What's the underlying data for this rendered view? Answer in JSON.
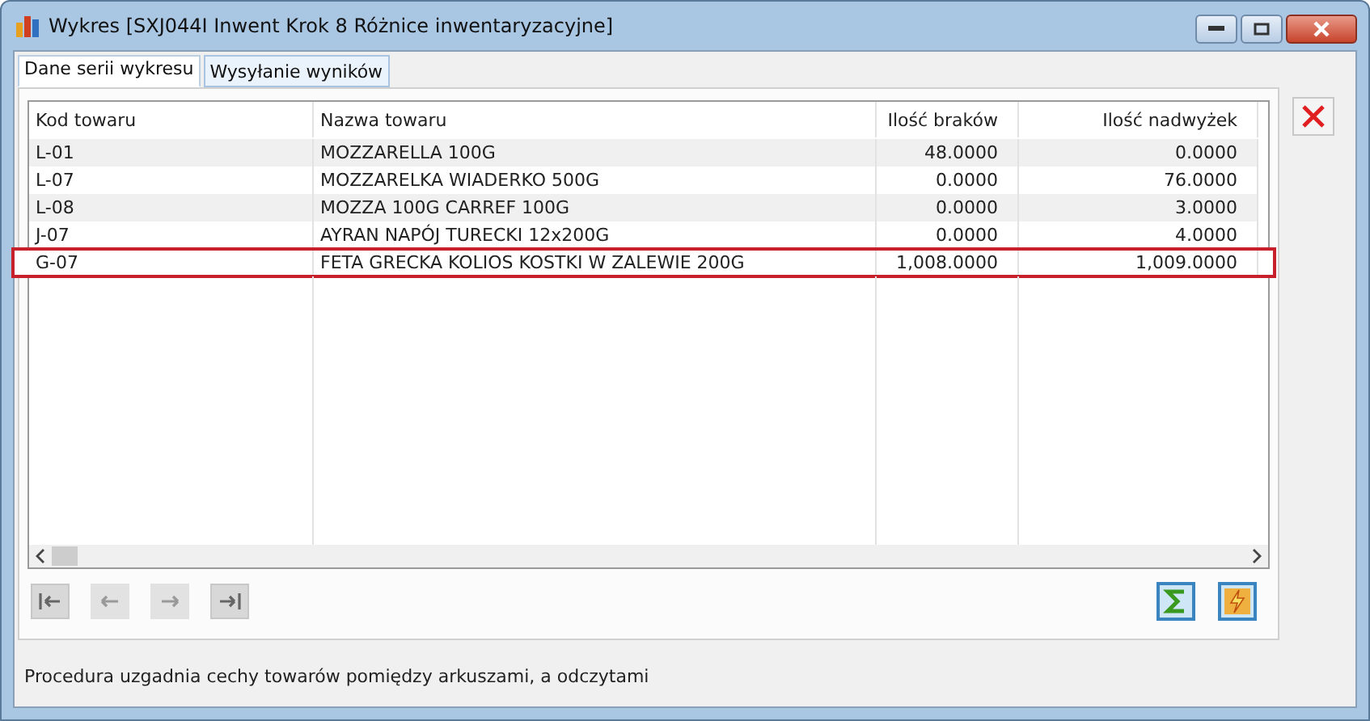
{
  "window": {
    "title": "Wykres [SXJ044I  Inwent Krok 8 Różnice inwentaryzacyjne]"
  },
  "tabs": [
    {
      "label": "Dane serii wykresu",
      "selected": true
    },
    {
      "label": "Wysyłanie wyników",
      "selected": false
    }
  ],
  "table": {
    "columns": [
      "Kod towaru",
      "Nazwa towaru",
      "Ilość braków",
      "Ilość nadwyżek"
    ],
    "rows": [
      {
        "cells": [
          "L-01",
          "MOZZARELLA 100G",
          "48.0000",
          "0.0000"
        ],
        "selected": false
      },
      {
        "cells": [
          "L-07",
          "MOZZARELKA WIADERKO 500G",
          "0.0000",
          "76.0000"
        ],
        "selected": false
      },
      {
        "cells": [
          "L-08",
          "MOZZA 100G CARREF 100G",
          "0.0000",
          "3.0000"
        ],
        "selected": false
      },
      {
        "cells": [
          "J-07",
          "AYRAN NAPÓJ TURECKI 12x200G",
          "0.0000",
          "4.0000"
        ],
        "selected": false
      },
      {
        "cells": [
          "G-07",
          "FETA GRECKA KOLIOS KOSTKI W ZALEWIE 200G",
          "1,008.0000",
          "1,009.0000"
        ],
        "selected": true
      }
    ]
  },
  "nav_buttons": [
    {
      "kind": "first",
      "disabled": false
    },
    {
      "kind": "prev",
      "disabled": true
    },
    {
      "kind": "next",
      "disabled": true
    },
    {
      "kind": "last",
      "disabled": false
    }
  ],
  "status_bar": {
    "text": "Procedura uzgadnia cechy towarów pomiędzy arkuszami, a odczytami"
  }
}
